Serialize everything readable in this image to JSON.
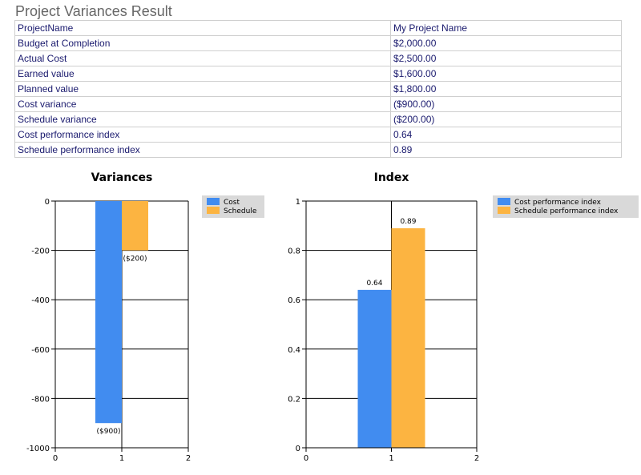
{
  "page": {
    "title": "Project Variances Result"
  },
  "table": {
    "rows": [
      {
        "label": "ProjectName",
        "value": "My Project Name"
      },
      {
        "label": "Budget at Completion",
        "value": "$2,000.00"
      },
      {
        "label": "Actual Cost",
        "value": "$2,500.00"
      },
      {
        "label": "Earned value",
        "value": "$1,600.00"
      },
      {
        "label": "Planned value",
        "value": "$1,800.00"
      },
      {
        "label": "Cost variance",
        "value": "($900.00)"
      },
      {
        "label": "Schedule variance",
        "value": "($200.00)"
      },
      {
        "label": "Cost performance index",
        "value": "0.64"
      },
      {
        "label": "Schedule performance index",
        "value": "0.89"
      }
    ]
  },
  "colors": {
    "series1": "#418cf0",
    "series2": "#fcb441",
    "legend_bg": "#d9d9d9",
    "text": "#1a1a6e"
  },
  "chart_data": [
    {
      "type": "bar",
      "title": "Variances",
      "x": [
        1
      ],
      "xlim": [
        0,
        2
      ],
      "xticks": [
        0,
        1,
        2
      ],
      "ylim": [
        -1000,
        0
      ],
      "yticks": [
        0,
        -200,
        -400,
        -600,
        -800,
        -1000
      ],
      "grid": true,
      "legend_position": "top-right",
      "series": [
        {
          "name": "Cost",
          "values": [
            -900
          ],
          "labels": [
            "($900)"
          ]
        },
        {
          "name": "Schedule",
          "values": [
            -200
          ],
          "labels": [
            "($200)"
          ]
        }
      ]
    },
    {
      "type": "bar",
      "title": "Index",
      "x": [
        1
      ],
      "xlim": [
        0,
        2
      ],
      "xticks": [
        0,
        1,
        2
      ],
      "ylim": [
        0,
        1
      ],
      "yticks": [
        0,
        0.2,
        0.4,
        0.6,
        0.8,
        1
      ],
      "grid": true,
      "legend_position": "top-right",
      "series": [
        {
          "name": "Cost performance index",
          "values": [
            0.64
          ],
          "labels": [
            "0.64"
          ]
        },
        {
          "name": "Schedule performance index",
          "values": [
            0.89
          ],
          "labels": [
            "0.89"
          ]
        }
      ]
    }
  ]
}
